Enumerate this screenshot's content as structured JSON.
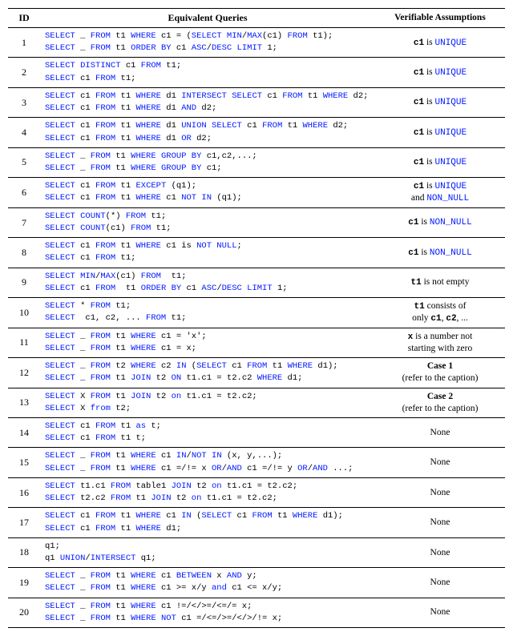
{
  "headers": {
    "id": "ID",
    "queries": "Equivalent Queries",
    "assumptions": "Verifiable Assumptions"
  },
  "rows": [
    {
      "id": "1",
      "q1": "<span class='kw'>SELECT</span> _ <span class='kw'>FROM</span> t1 <span class='kw'>WHERE</span> c1 = (<span class='kw'>SELECT</span> <span class='kw'>MIN</span>/<span class='kw'>MAX</span>(c1) <span class='kw'>FROM</span> t1);",
      "q2": "<span class='kw'>SELECT</span> _ <span class='kw'>FROM</span> t1 <span class='kw'>ORDER BY</span> c1 <span class='kw'>ASC</span>/<span class='kw'>DESC</span> <span class='kw'>LIMIT</span> 1;",
      "assumption": "<span class='tt b'>c1</span> is <span class='tt kw'>UNIQUE</span>"
    },
    {
      "id": "2",
      "q1": "<span class='kw'>SELECT</span> <span class='kw'>DISTINCT</span> c1 <span class='kw'>FROM</span> t1;",
      "q2": "<span class='kw'>SELECT</span> c1 <span class='kw'>FROM</span> t1;",
      "assumption": "<span class='tt b'>c1</span> is <span class='tt kw'>UNIQUE</span>"
    },
    {
      "id": "3",
      "q1": "<span class='kw'>SELECT</span> c1 <span class='kw'>FROM</span> t1 <span class='kw'>WHERE</span> d1 <span class='kw'>INTERSECT</span> <span class='kw'>SELECT</span> c1 <span class='kw'>FROM</span> t1 <span class='kw'>WHERE</span> d2;",
      "q2": "<span class='kw'>SELECT</span> c1 <span class='kw'>FROM</span> t1 <span class='kw'>WHERE</span> d1 <span class='kw'>AND</span> d2;",
      "assumption": "<span class='tt b'>c1</span> is <span class='tt kw'>UNIQUE</span>"
    },
    {
      "id": "4",
      "q1": "<span class='kw'>SELECT</span> c1 <span class='kw'>FROM</span> t1 <span class='kw'>WHERE</span> d1 <span class='kw'>UNION</span> <span class='kw'>SELECT</span> c1 <span class='kw'>FROM</span> t1 <span class='kw'>WHERE</span> d2;",
      "q2": "<span class='kw'>SELECT</span> c1 <span class='kw'>FROM</span> t1 <span class='kw'>WHERE</span> d1 <span class='kw'>OR</span> d2;",
      "assumption": "<span class='tt b'>c1</span> is <span class='tt kw'>UNIQUE</span>"
    },
    {
      "id": "5",
      "q1": "<span class='kw'>SELECT</span> _ <span class='kw'>FROM</span> t1 <span class='kw'>WHERE</span> <span class='kw'>GROUP BY</span> c1,c2,...;",
      "q2": "<span class='kw'>SELECT</span> _ <span class='kw'>FROM</span> t1 <span class='kw'>WHERE</span> <span class='kw'>GROUP BY</span> c1;",
      "assumption": "<span class='tt b'>c1</span> is <span class='tt kw'>UNIQUE</span>"
    },
    {
      "id": "6",
      "q1": "<span class='kw'>SELECT</span> c1 <span class='kw'>FROM</span> t1 <span class='kw'>EXCEPT</span> (q1);",
      "q2": "<span class='kw'>SELECT</span> c1 <span class='kw'>FROM</span> t1 <span class='kw'>WHERE</span> c1 <span class='kw'>NOT IN</span> (q1);",
      "assumption": "<span class='tt b'>c1</span> is <span class='tt kw'>UNIQUE</span><br>and <span class='tt kw'>NON_NULL</span>"
    },
    {
      "id": "7",
      "q1": "<span class='kw'>SELECT</span> <span class='kw'>COUNT</span>(*) <span class='kw'>FROM</span> t1;",
      "q2": "<span class='kw'>SELECT</span> <span class='kw'>COUNT</span>(c1) <span class='kw'>FROM</span> t1;",
      "assumption": "<span class='tt b'>c1</span> is <span class='tt kw'>NON_NULL</span>"
    },
    {
      "id": "8",
      "q1": "<span class='kw'>SELECT</span> c1 <span class='kw'>FROM</span> t1 <span class='kw'>WHERE</span> c1 is <span class='kw'>NOT NULL</span>;",
      "q2": "<span class='kw'>SELECT</span> c1 <span class='kw'>FROM</span> t1;",
      "assumption": "<span class='tt b'>c1</span> is <span class='tt kw'>NON_NULL</span>"
    },
    {
      "id": "9",
      "q1": "<span class='kw'>SELECT</span> <span class='kw'>MIN</span>/<span class='kw'>MAX</span>(c1) <span class='kw'>FROM</span>  t1;",
      "q2": "<span class='kw'>SELECT</span> c1 <span class='kw'>FROM</span>  t1 <span class='kw'>ORDER BY</span> c1 <span class='kw'>ASC</span>/<span class='kw'>DESC</span> <span class='kw'>LIMIT</span> 1;",
      "assumption": "<span class='tt b'>t1</span> is not empty"
    },
    {
      "id": "10",
      "q1": "<span class='kw'>SELECT</span> * <span class='kw'>FROM</span> t1;",
      "q2": "<span class='kw'>SELECT</span>  c1, c2, ... <span class='kw'>FROM</span> t1;",
      "assumption": "<span class='tt b'>t1</span> consists of<br>only <span class='tt b'>c1</span>, <span class='tt b'>c2</span>, ..."
    },
    {
      "id": "11",
      "q1": "<span class='kw'>SELECT</span> _ <span class='kw'>FROM</span> t1 <span class='kw'>WHERE</span> c1 = 'x';",
      "q2": "<span class='kw'>SELECT</span> _ <span class='kw'>FROM</span> t1 <span class='kw'>WHERE</span> c1 = x;",
      "assumption": "<span class='tt b'>x</span> is a number not<br>starting with zero"
    },
    {
      "id": "12",
      "q1": "<span class='kw'>SELECT</span> _ <span class='kw'>FROM</span> t2 <span class='kw'>WHERE</span> c2 <span class='kw'>IN</span> (<span class='kw'>SELECT</span> c1 <span class='kw'>FROM</span> t1 <span class='kw'>WHERE</span> d1);",
      "q2": "<span class='kw'>SELECT</span> _ <span class='kw'>FROM</span> t1 <span class='kw'>JOIN</span> t2 <span class='kw'>ON</span> t1.c1 = t2.c2 <span class='kw'>WHERE</span> d1;",
      "assumption": "<span class='b'>Case 1</span><br>(refer to the caption)"
    },
    {
      "id": "13",
      "q1": "<span class='kw'>SELECT</span> X <span class='kw'>FROM</span> t1 <span class='kw'>JOIN</span> t2 <span class='kw'>on</span> t1.c1 = t2.c2;",
      "q2": "<span class='kw'>SELECT</span> X <span class='kw'>from</span> t2;",
      "assumption": "<span class='b'>Case 2</span><br>(refer to the caption)"
    },
    {
      "id": "14",
      "q1": "<span class='kw'>SELECT</span> c1 <span class='kw'>FROM</span> t1 <span class='kw'>as</span> t;",
      "q2": "<span class='kw'>SELECT</span> c1 <span class='kw'>FROM</span> t1 t;",
      "assumption": "None"
    },
    {
      "id": "15",
      "q1": "<span class='kw'>SELECT</span> _ <span class='kw'>FROM</span> t1 <span class='kw'>WHERE</span> c1 <span class='kw'>IN</span>/<span class='kw'>NOT IN</span> (x, y,...);",
      "q2": "<span class='kw'>SELECT</span> _ <span class='kw'>FROM</span> t1 <span class='kw'>WHERE</span> c1 =/!= x <span class='kw'>OR</span>/<span class='kw'>AND</span> c1 =/!= y <span class='kw'>OR</span>/<span class='kw'>AND</span> ...;",
      "assumption": "None"
    },
    {
      "id": "16",
      "q1": "<span class='kw'>SELECT</span> t1.c1 <span class='kw'>FROM</span> table1 <span class='kw'>JOIN</span> t2 <span class='kw'>on</span> t1.c1 = t2.c2;",
      "q2": "<span class='kw'>SELECT</span> t2.c2 <span class='kw'>FROM</span> t1 <span class='kw'>JOIN</span> t2 <span class='kw'>on</span> t1.c1 = t2.c2;",
      "assumption": "None"
    },
    {
      "id": "17",
      "q1": "<span class='kw'>SELECT</span> c1 <span class='kw'>FROM</span> t1 <span class='kw'>WHERE</span> c1 <span class='kw'>IN</span> (<span class='kw'>SELECT</span> c1 <span class='kw'>FROM</span> t1 <span class='kw'>WHERE</span> d1);",
      "q2": "<span class='kw'>SELECT</span> c1 <span class='kw'>FROM</span> t1 <span class='kw'>WHERE</span> d1;",
      "assumption": "None"
    },
    {
      "id": "18",
      "q1": "q1;",
      "q2": "q1 <span class='kw'>UNION</span>/<span class='kw'>INTERSECT</span> q1;",
      "assumption": "None"
    },
    {
      "id": "19",
      "q1": "<span class='kw'>SELECT</span> _ <span class='kw'>FROM</span> t1 <span class='kw'>WHERE</span> c1 <span class='kw'>BETWEEN</span> x <span class='kw'>AND</span> y;",
      "q2": "<span class='kw'>SELECT</span> _ <span class='kw'>FROM</span> t1 <span class='kw'>WHERE</span> c1 &gt;= x/y <span class='kw'>and</span> c1 &lt;= x/y;",
      "assumption": "None"
    },
    {
      "id": "20",
      "q1": "<span class='kw'>SELECT</span> _ <span class='kw'>FROM</span> t1 <span class='kw'>WHERE</span> c1 !=/&lt;/&gt;=/&lt;=/= x;",
      "q2": "<span class='kw'>SELECT</span> _ <span class='kw'>FROM</span> t1 <span class='kw'>WHERE</span> <span class='kw'>NOT</span> c1 =/&lt;=/&gt;=/&lt;/&gt;/!= x;",
      "assumption": "None"
    }
  ]
}
